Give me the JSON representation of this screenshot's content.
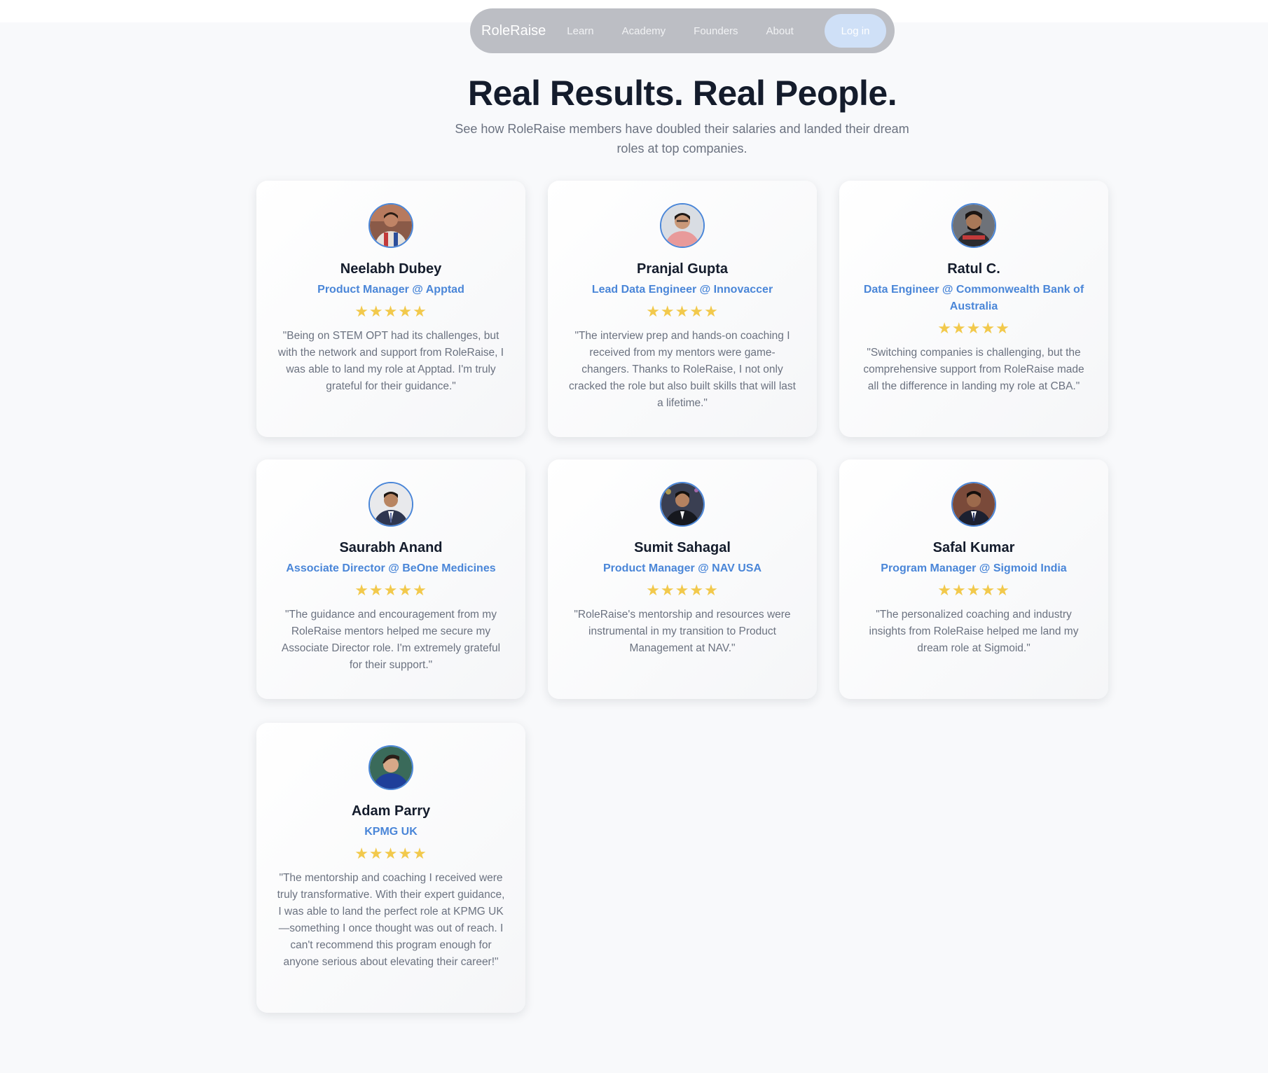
{
  "nav": {
    "brand": "RoleRaise",
    "links": [
      "Learn",
      "Academy",
      "Founders",
      "About"
    ],
    "login": "Log in"
  },
  "header": {
    "title": "Real Results. Real People.",
    "subtitle": "See how RoleRaise members have doubled their salaries and landed their dream roles at top companies."
  },
  "stars": "★★★★★",
  "testimonials": [
    {
      "name": "Neelabh Dubey",
      "role": "Product Manager @ Apptad",
      "quote": "\"Being on STEM OPT had its challenges, but with the network and support from RoleRaise, I was able to land my role at Apptad. I'm truly grateful for their guidance.\""
    },
    {
      "name": "Pranjal Gupta",
      "role": "Lead Data Engineer @ Innovaccer",
      "quote": "\"The interview prep and hands-on coaching I received from my mentors were game-changers. Thanks to RoleRaise, I not only cracked the role but also built skills that will last a lifetime.\""
    },
    {
      "name": "Ratul C.",
      "role": "Data Engineer @ Commonwealth Bank of Australia",
      "quote": "\"Switching companies is challenging, but the comprehensive support from RoleRaise made all the difference in landing my role at CBA.\""
    },
    {
      "name": "Saurabh Anand",
      "role": "Associate Director @ BeOne Medicines",
      "quote": "\"The guidance and encouragement from my RoleRaise mentors helped me secure my Associate Director role. I'm extremely grateful for their support.\""
    },
    {
      "name": "Sumit Sahagal",
      "role": "Product Manager @ NAV USA",
      "quote": "\"RoleRaise's mentorship and resources were instrumental in my transition to Product Management at NAV.\""
    },
    {
      "name": "Safal Kumar",
      "role": "Program Manager @ Sigmoid India",
      "quote": "\"The personalized coaching and industry insights from RoleRaise helped me land my dream role at Sigmoid.\""
    },
    {
      "name": "Adam Parry",
      "role": "KPMG UK",
      "quote": "\"The mentorship and coaching I received were truly transformative. With their expert guidance, I was able to land the perfect role at KPMG UK—something I once thought was out of reach. I can't recommend this program enough for anyone serious about elevating their career!\""
    }
  ],
  "colors": {
    "accent": "#4a86d8",
    "star": "#f2c94c",
    "title": "#141c2c",
    "nav_bg": "#bcbec4",
    "login_bg": "#cfe0f7"
  }
}
